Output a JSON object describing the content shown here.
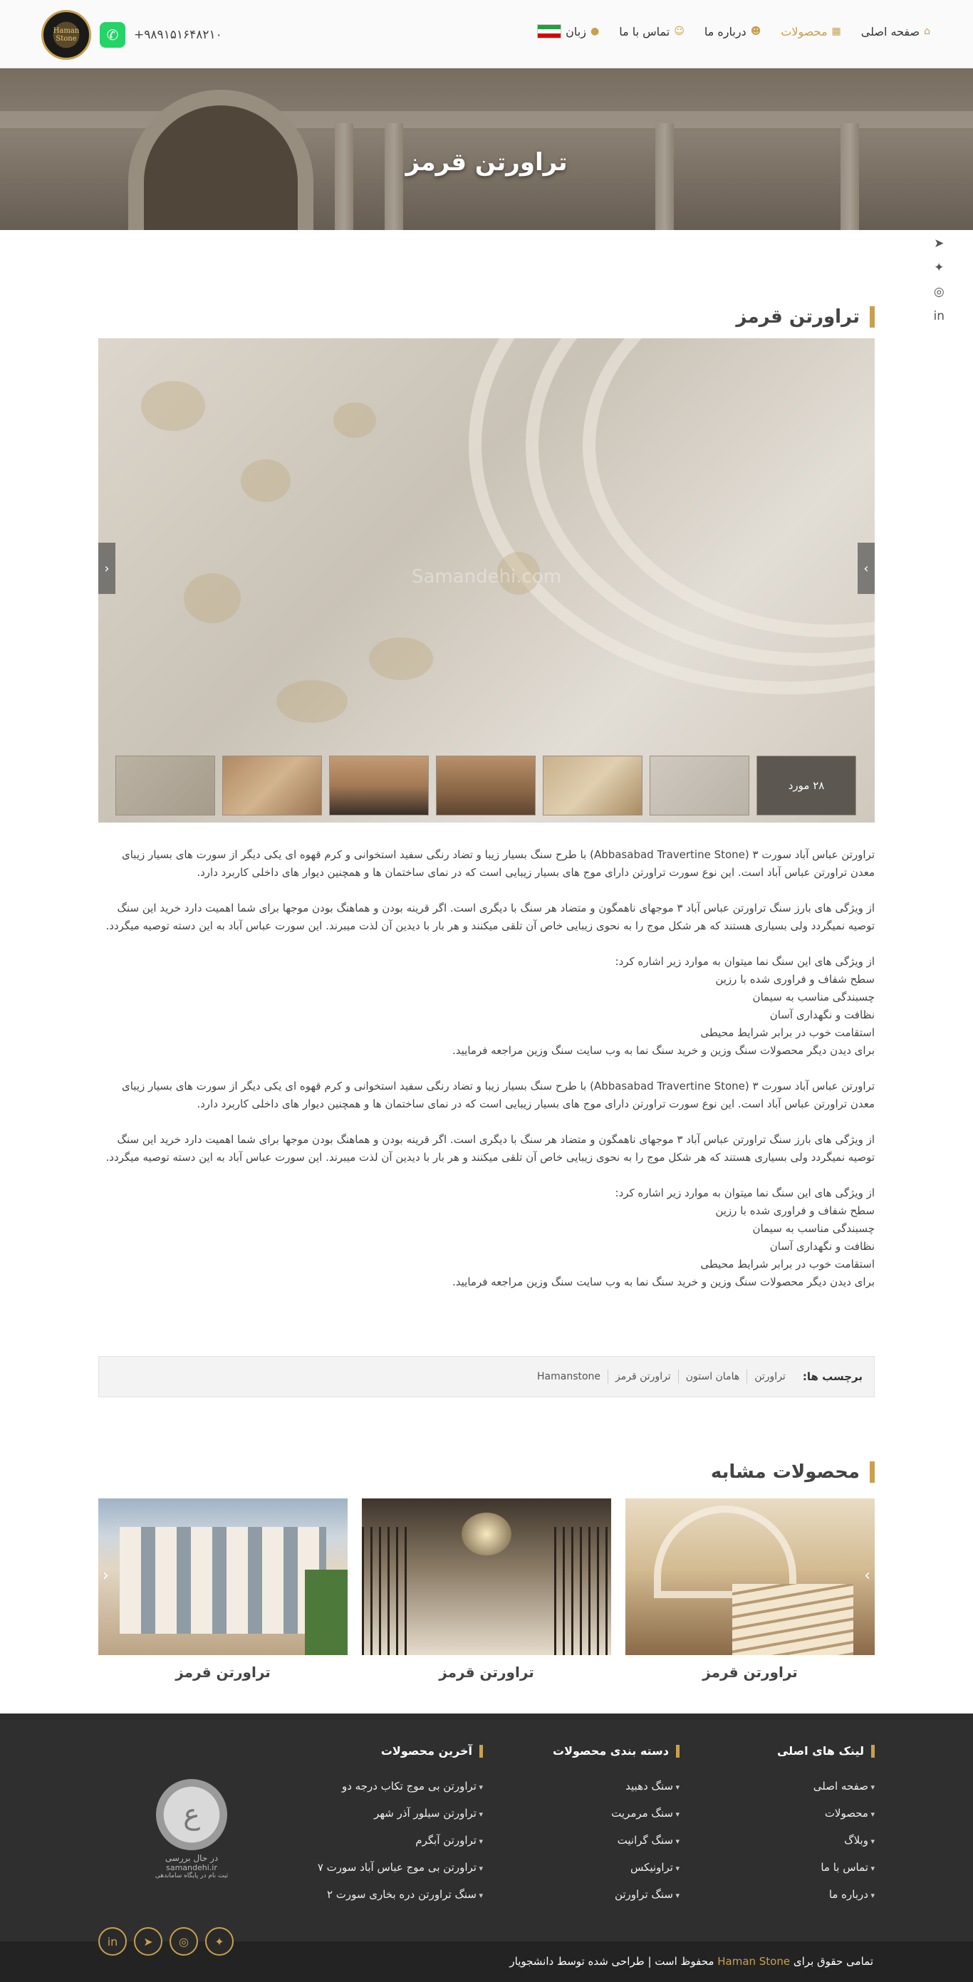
{
  "header": {
    "nav": [
      {
        "label": "صفحه اصلی",
        "icon": "home-icon",
        "active": false
      },
      {
        "label": "محصولات",
        "icon": "boxes-icon",
        "active": true
      },
      {
        "label": "درباره ما",
        "icon": "users-icon",
        "active": false
      },
      {
        "label": "تماس با ما",
        "icon": "user-icon",
        "active": false
      },
      {
        "label": "زبان",
        "icon": "globe-icon",
        "active": false
      }
    ],
    "phone": "+۹۸۹۱۵۱۶۴۸۲۱۰",
    "logo_text": "Haman Stone"
  },
  "hero": {
    "title": "تراورتن قرمز"
  },
  "product": {
    "title": "تراورتن قرمز",
    "gallery_watermark": "Samandehi.com",
    "gallery_count": "۲۸ مورد",
    "paragraph1": "تراورتن عباس آباد سورت ۳ (Abbasabad Travertine Stone) با طرح سنگ بسیار زیبا و تضاد رنگی سفید استخوانی و کرم قهوه ای یکی دیگر از سورت های بسیار زیبای معدن تراورتن عباس آباد است. این نوع سورت تراورتن  دارای موج های بسیار زیبایی است که در نمای ساختمان ها و همچنین دیوار های داخلی کاربرد دارد.",
    "paragraph2": "از ویژگی های بارز سنگ تراورتن عباس آباد ۳ موجهای ناهمگون و متضاد هر سنگ با دیگری است. اگر قرینه بودن و هماهنگ بودن موجها برای شما اهمیت دارد خرید این سنگ توصیه نمیگردد ولی بسیاری هستند که هر شکل موج را به نحوی زیبایی خاص آن تلقی میکنند و هر بار با دیدین آن لذت میبرند. این سورت عباس آباد به این دسته توصیه میگردد.",
    "features_intro": "از ویژگی های این سنگ نما میتوان به موارد زیر اشاره کرد:",
    "features": [
      "سطح شفاف و فراوری شده با رزین",
      "چسبندگی مناسب به سیمان",
      "نظافت و نگهداری آسان",
      "استقامت خوب در برابر شرایط محیطی"
    ],
    "more_text": "برای دیدن دیگر محصولات سنگ وزین و خرید سنگ نما به وب سایت سنگ وزین مراجعه فرمایید."
  },
  "tags": {
    "label": "برچسب ها:",
    "items": [
      "تراورتن",
      "هامان استون",
      "تراورتن قرمز",
      "Hamanstone"
    ]
  },
  "similar": {
    "title": "محصولات مشابه",
    "items": [
      {
        "caption": "تراورتن قرمز"
      },
      {
        "caption": "تراورتن قرمز"
      },
      {
        "caption": "تراورتن قرمز"
      }
    ]
  },
  "footer": {
    "main_links": {
      "title": "لینک های اصلی",
      "items": [
        "صفحه اصلی",
        "محصولات",
        "وبلاگ",
        "تماس با ما",
        "درباره ما"
      ]
    },
    "categories": {
      "title": "دسته بندی محصولات",
      "items": [
        "سنگ دهبید",
        "سنگ مرمریت",
        "سنگ گرانیت",
        "تراونیکس",
        "سنگ تراورتن"
      ]
    },
    "latest": {
      "title": "آخرین محصولات",
      "items": [
        "تراورتن بی موج تکاب درجه دو",
        "تراورتن سیلور آذر شهر",
        "تراورتن آبگرم",
        "تراورتن بی موج عباس آباد سورت ۷",
        "سنگ تراورتن دره بخاری سورت ۲"
      ]
    },
    "seal": {
      "text1": "در حال بررسی",
      "text2": "samandehi.ir",
      "text3": "ثبت نام در پایگاه ساماندهی"
    },
    "copyright_pre": "تمامی حقوق برای",
    "copyright_brand": "Haman Stone",
    "copyright_post": "محفوظ است | طراحی شده توسط دانشجویار"
  },
  "colors": {
    "accent": "#c9a04d",
    "footer_bg": "#2f2f2f",
    "bottom_bg": "#232323"
  }
}
